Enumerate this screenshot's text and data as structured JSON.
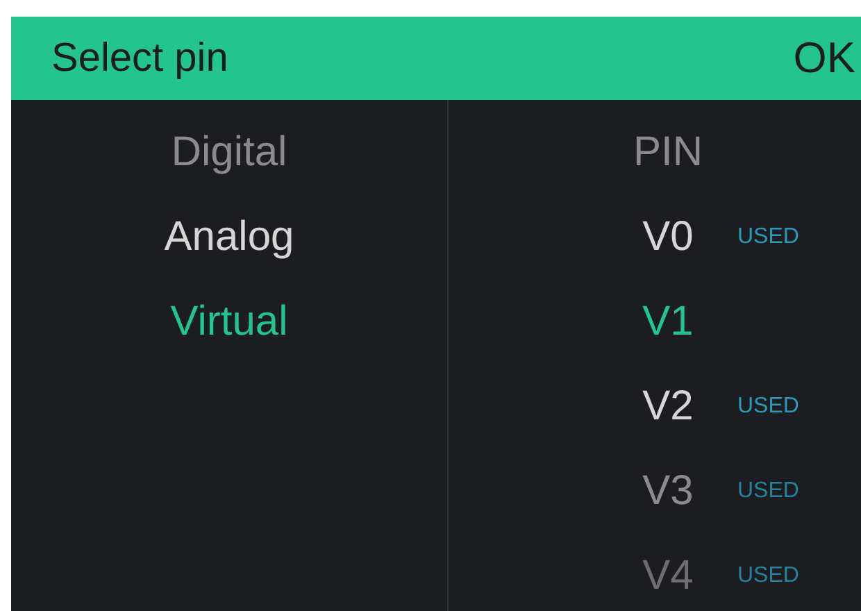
{
  "header": {
    "title": "Select pin",
    "action": "OK"
  },
  "pin_types": [
    {
      "label": "Digital",
      "selected": false
    },
    {
      "label": "Analog",
      "selected": false
    },
    {
      "label": "Virtual",
      "selected": true
    }
  ],
  "pins": [
    {
      "label": "PIN",
      "selected": false
    },
    {
      "label": "V0",
      "used_label": "USED",
      "selected": false
    },
    {
      "label": "V1",
      "selected": true
    },
    {
      "label": "V2",
      "used_label": "USED",
      "selected": false
    },
    {
      "label": "V3",
      "used_label": "USED",
      "selected": false
    },
    {
      "label": "V4",
      "used_label": "USED",
      "selected": false
    }
  ]
}
